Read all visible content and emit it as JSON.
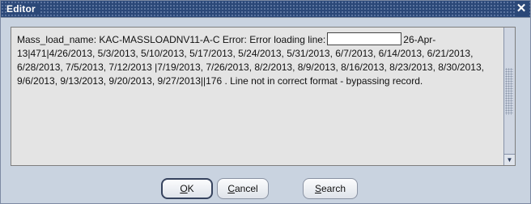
{
  "window": {
    "title": "Editor",
    "close_icon": "close-icon"
  },
  "editor": {
    "text_before_field": "Mass_load_name: KAC-MASSLOADNV11-A-C Error:  Error loading line:",
    "text_after_field": "26-Apr-13|471|4/26/2013, 5/3/2013, 5/10/2013, 5/17/2013, 5/24/2013, 5/31/2013, 6/7/2013, 6/14/2013, 6/21/2013, 6/28/2013, 7/5/2013, 7/12/2013 |7/19/2013, 7/26/2013, 8/2/2013, 8/9/2013, 8/16/2013, 8/23/2013, 8/30/2013, 9/6/2013, 9/13/2013, 9/20/2013, 9/27/2013||176 . Line not in correct format  - bypassing record."
  },
  "buttons": {
    "ok": {
      "mnemonic": "O",
      "rest": "K"
    },
    "cancel": {
      "mnemonic": "C",
      "rest": "ancel"
    },
    "search": {
      "mnemonic": "S",
      "rest": "earch"
    }
  }
}
